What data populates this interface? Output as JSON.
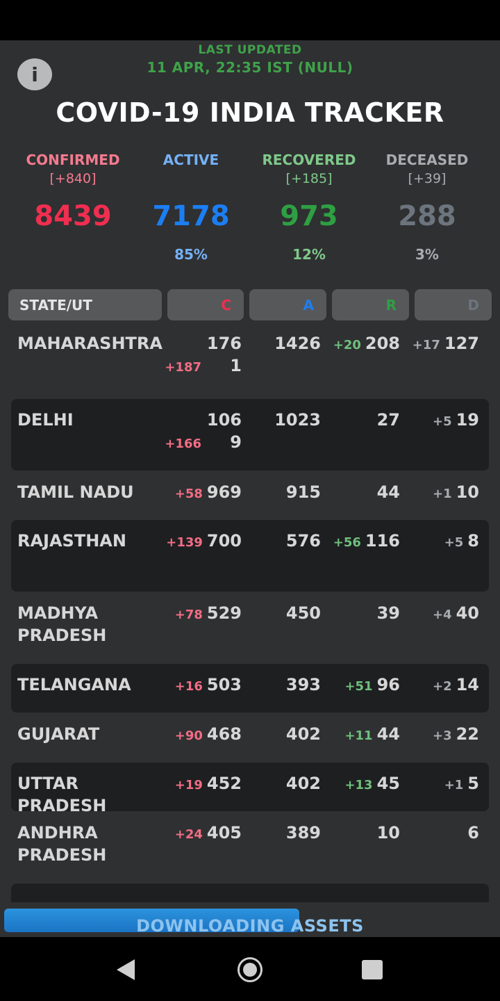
{
  "header": {
    "last_updated_label": "LAST UPDATED",
    "last_updated_value": "11 APR, 22:35 IST (NULL)",
    "title": "COVID-19 INDIA TRACKER",
    "info_icon": "i"
  },
  "stats": {
    "confirmed": {
      "label": "CONFIRMED",
      "delta": "[+840]",
      "value": "8439",
      "percent": ""
    },
    "active": {
      "label": "ACTIVE",
      "delta": "",
      "value": "7178",
      "percent": "85%"
    },
    "recovered": {
      "label": "RECOVERED",
      "delta": "[+185]",
      "value": "973",
      "percent": "12%"
    },
    "deceased": {
      "label": "DECEASED",
      "delta": "[+39]",
      "value": "288",
      "percent": "3%"
    }
  },
  "table": {
    "headers": {
      "state": "STATE/UT",
      "confirmed": "C",
      "active": "A",
      "recovered": "R",
      "deceased": "D"
    },
    "rows": [
      {
        "name": "MAHARASHTRA",
        "c_delta": "+187",
        "c": "1761",
        "a": "1426",
        "r_delta": "+20",
        "r": "208",
        "d_delta": "+17",
        "d": "127"
      },
      {
        "name": "DELHI",
        "c_delta": "+166",
        "c": "1069",
        "a": "1023",
        "r_delta": "",
        "r": "27",
        "d_delta": "+5",
        "d": "19"
      },
      {
        "name": "TAMIL NADU",
        "c_delta": "+58",
        "c": "969",
        "a": "915",
        "r_delta": "",
        "r": "44",
        "d_delta": "+1",
        "d": "10"
      },
      {
        "name": "RAJASTHAN",
        "c_delta": "+139",
        "c": "700",
        "a": "576",
        "r_delta": "+56",
        "r": "116",
        "d_delta": "+5",
        "d": "8"
      },
      {
        "name": "MADHYA PRADESH",
        "c_delta": "+78",
        "c": "529",
        "a": "450",
        "r_delta": "",
        "r": "39",
        "d_delta": "+4",
        "d": "40"
      },
      {
        "name": "TELANGANA",
        "c_delta": "+16",
        "c": "503",
        "a": "393",
        "r_delta": "+51",
        "r": "96",
        "d_delta": "+2",
        "d": "14"
      },
      {
        "name": "GUJARAT",
        "c_delta": "+90",
        "c": "468",
        "a": "402",
        "r_delta": "+11",
        "r": "44",
        "d_delta": "+3",
        "d": "22"
      },
      {
        "name": "UTTAR PRADESH",
        "c_delta": "+19",
        "c": "452",
        "a": "402",
        "r_delta": "+13",
        "r": "45",
        "d_delta": "+1",
        "d": "5"
      },
      {
        "name": "ANDHRA PRADESH",
        "c_delta": "+24",
        "c": "405",
        "a": "389",
        "r_delta": "",
        "r": "10",
        "d_delta": "",
        "d": "6"
      }
    ]
  },
  "download": {
    "label": "DOWNLOADING ASSETS",
    "progress": 0.6
  },
  "nav": {
    "back_icon": "back-triangle-icon",
    "home_icon": "home-circle-icon",
    "recents_icon": "recents-square-icon"
  }
}
